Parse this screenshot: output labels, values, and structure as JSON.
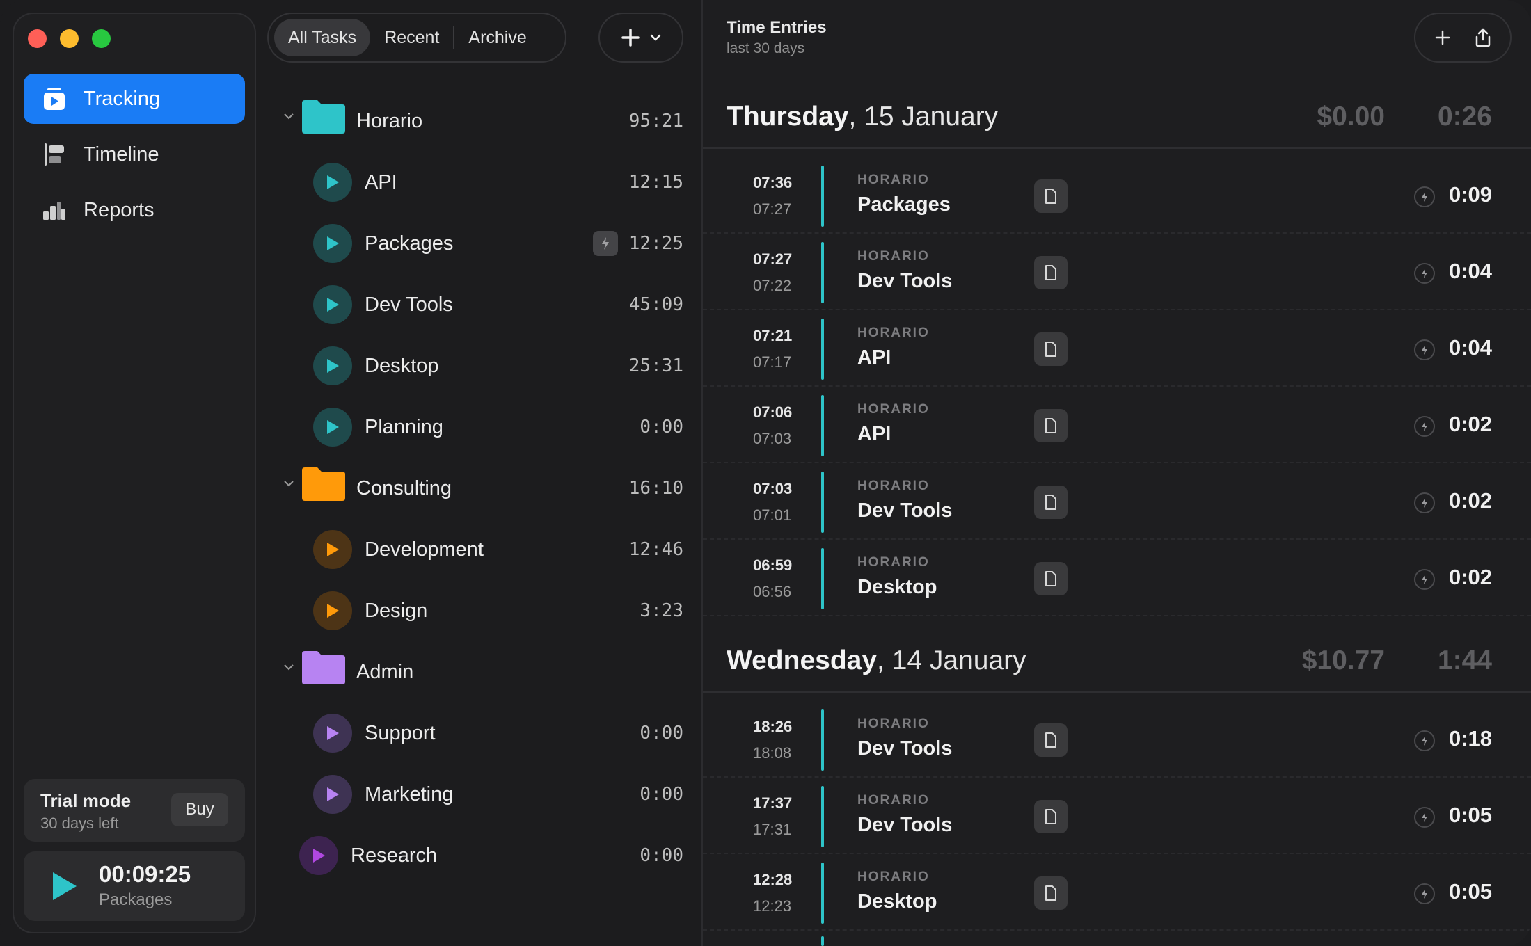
{
  "sidebar": {
    "nav": [
      {
        "label": "Tracking",
        "icon": "tracking-icon",
        "active": true
      },
      {
        "label": "Timeline",
        "icon": "timeline-icon",
        "active": false
      },
      {
        "label": "Reports",
        "icon": "reports-icon",
        "active": false
      }
    ],
    "trial": {
      "title": "Trial mode",
      "subtitle": "30 days left",
      "buy_label": "Buy"
    },
    "timer": {
      "time": "00:09:25",
      "task": "Packages"
    }
  },
  "tasks_panel": {
    "tabs": [
      {
        "label": "All Tasks",
        "active": true
      },
      {
        "label": "Recent",
        "active": false
      },
      {
        "label": "Archive",
        "active": false
      }
    ],
    "projects": [
      {
        "name": "Horario",
        "duration": "95:21",
        "color": "#2ec4c9",
        "tasks": [
          {
            "name": "API",
            "duration": "12:15"
          },
          {
            "name": "Packages",
            "duration": "12:25",
            "running": true
          },
          {
            "name": "Dev Tools",
            "duration": "45:09"
          },
          {
            "name": "Desktop",
            "duration": "25:31"
          },
          {
            "name": "Planning",
            "duration": "0:00"
          }
        ]
      },
      {
        "name": "Consulting",
        "duration": "16:10",
        "color": "#ff9a0a",
        "tasks": [
          {
            "name": "Development",
            "duration": "12:46"
          },
          {
            "name": "Design",
            "duration": "3:23"
          }
        ]
      },
      {
        "name": "Admin",
        "duration": "",
        "color": "#b783f2",
        "tasks": [
          {
            "name": "Support",
            "duration": "0:00"
          },
          {
            "name": "Marketing",
            "duration": "0:00"
          }
        ]
      }
    ],
    "loose_tasks": [
      {
        "name": "Research",
        "duration": "0:00",
        "color": "#b048e0"
      }
    ]
  },
  "entries_panel": {
    "title": "Time Entries",
    "subtitle": "last 30 days",
    "days": [
      {
        "weekday": "Thursday",
        "date": ", 15 January",
        "amount": "$0.00",
        "duration": "0:26",
        "entries": [
          {
            "start": "07:36",
            "end": "07:27",
            "project": "HORARIO",
            "task": "Packages",
            "duration": "0:09"
          },
          {
            "start": "07:27",
            "end": "07:22",
            "project": "HORARIO",
            "task": "Dev Tools",
            "duration": "0:04"
          },
          {
            "start": "07:21",
            "end": "07:17",
            "project": "HORARIO",
            "task": "API",
            "duration": "0:04"
          },
          {
            "start": "07:06",
            "end": "07:03",
            "project": "HORARIO",
            "task": "API",
            "duration": "0:02"
          },
          {
            "start": "07:03",
            "end": "07:01",
            "project": "HORARIO",
            "task": "Dev Tools",
            "duration": "0:02"
          },
          {
            "start": "06:59",
            "end": "06:56",
            "project": "HORARIO",
            "task": "Desktop",
            "duration": "0:02"
          }
        ]
      },
      {
        "weekday": "Wednesday",
        "date": ", 14 January",
        "amount": "$10.77",
        "duration": "1:44",
        "entries": [
          {
            "start": "18:26",
            "end": "18:08",
            "project": "HORARIO",
            "task": "Dev Tools",
            "duration": "0:18"
          },
          {
            "start": "17:37",
            "end": "17:31",
            "project": "HORARIO",
            "task": "Dev Tools",
            "duration": "0:05"
          },
          {
            "start": "12:28",
            "end": "12:23",
            "project": "HORARIO",
            "task": "Desktop",
            "duration": "0:05"
          }
        ]
      }
    ]
  },
  "colors": {
    "accent": "#1a7cf5",
    "horario": "#2ec4c9",
    "consulting": "#ff9a0a",
    "admin": "#b783f2",
    "research": "#b048e0"
  }
}
